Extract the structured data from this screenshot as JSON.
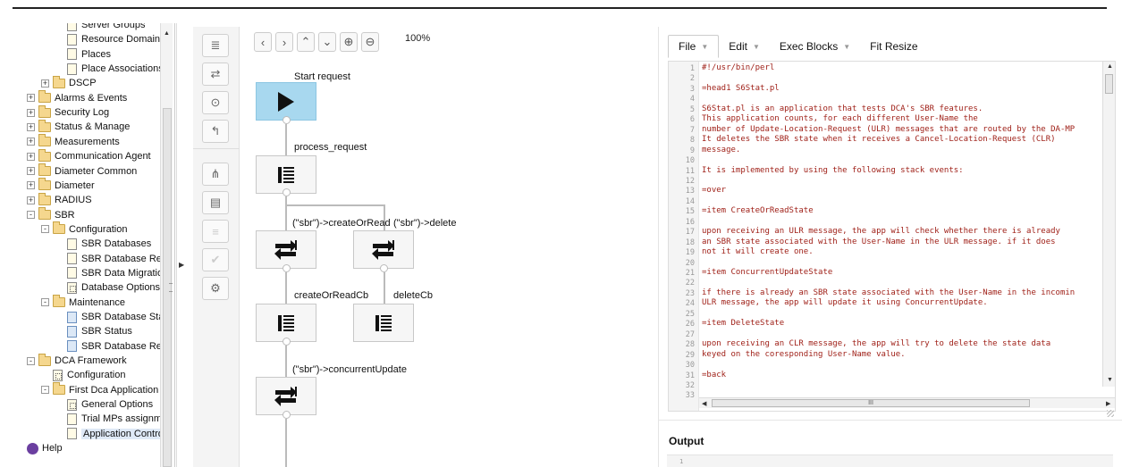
{
  "tree": {
    "items": [
      {
        "label": "Server Groups",
        "icon": "doc-icon",
        "level": 2
      },
      {
        "label": "Resource Domains",
        "icon": "doc-icon",
        "level": 2
      },
      {
        "label": "Places",
        "icon": "doc-icon",
        "level": 2
      },
      {
        "label": "Place Associations",
        "icon": "doc-icon",
        "level": 2
      },
      {
        "label": "DSCP",
        "icon": "folder-icon",
        "level": 1,
        "toggle": "+"
      },
      {
        "label": "Alarms & Events",
        "icon": "folder-icon",
        "level": 0,
        "toggle": "+"
      },
      {
        "label": "Security Log",
        "icon": "folder-icon",
        "level": 0,
        "toggle": "+"
      },
      {
        "label": "Status & Manage",
        "icon": "folder-icon",
        "level": 0,
        "toggle": "+"
      },
      {
        "label": "Measurements",
        "icon": "folder-icon",
        "level": 0,
        "toggle": "+"
      },
      {
        "label": "Communication Agent",
        "icon": "folder-icon",
        "level": 0,
        "toggle": "+"
      },
      {
        "label": "Diameter Common",
        "icon": "folder-icon",
        "level": 0,
        "toggle": "+"
      },
      {
        "label": "Diameter",
        "icon": "folder-icon",
        "level": 0,
        "toggle": "+"
      },
      {
        "label": "RADIUS",
        "icon": "folder-icon",
        "level": 0,
        "toggle": "+"
      },
      {
        "label": "SBR",
        "icon": "folder-icon",
        "level": 0,
        "toggle": "-"
      },
      {
        "label": "Configuration",
        "icon": "folder-icon",
        "level": 1,
        "toggle": "-"
      },
      {
        "label": "SBR Databases",
        "icon": "doc-icon",
        "level": 2
      },
      {
        "label": "SBR Database Res",
        "icon": "doc-icon",
        "level": 2
      },
      {
        "label": "SBR Data Migration",
        "icon": "doc-icon",
        "level": 2
      },
      {
        "label": "Database Options",
        "icon": "grid-doc-icon",
        "level": 2
      },
      {
        "label": "Maintenance",
        "icon": "folder-icon",
        "level": 1,
        "toggle": "-"
      },
      {
        "label": "SBR Database Stat",
        "icon": "blue-doc-icon",
        "level": 2
      },
      {
        "label": "SBR Status",
        "icon": "blue-doc-icon",
        "level": 2
      },
      {
        "label": "SBR Database Rec",
        "icon": "blue-doc-icon",
        "level": 2
      },
      {
        "label": "DCA Framework",
        "icon": "folder-icon",
        "level": 0,
        "toggle": "-"
      },
      {
        "label": "Configuration",
        "icon": "grid-doc-icon",
        "level": 1
      },
      {
        "label": "First Dca Application",
        "icon": "folder-icon",
        "level": 1,
        "toggle": "-"
      },
      {
        "label": "General Options",
        "icon": "grid-doc-icon",
        "level": 2
      },
      {
        "label": "Trial MPs assignme",
        "icon": "doc-icon",
        "level": 2
      },
      {
        "label": "Application Control",
        "icon": "doc-icon",
        "level": 2,
        "selected": true
      },
      {
        "label": "Help",
        "icon": "help-icon",
        "level": 0
      }
    ]
  },
  "toolbar": {
    "zoom": "100%",
    "nav": [
      "<",
      ">",
      "^",
      "v",
      "+",
      "-"
    ]
  },
  "flow": {
    "start_label": "Start request",
    "process_label": "process_request",
    "create_label": "(\"sbr\")->createOrRead",
    "delete_label": "(\"sbr\")->delete",
    "create_cb_label": "createOrReadCb",
    "delete_cb_label": "deleteCb",
    "concurrent_label": "(\"sbr\")->concurrentUpdate"
  },
  "editor": {
    "menus": [
      {
        "label": "File",
        "has_caret": true
      },
      {
        "label": "Edit",
        "has_caret": true
      },
      {
        "label": "Exec Blocks",
        "has_caret": true
      },
      {
        "label": "Fit Resize",
        "has_caret": false
      }
    ],
    "code_lines": [
      "#!/usr/bin/perl",
      "",
      "=head1 S6Stat.pl",
      "",
      "S6Stat.pl is an application that tests DCA's SBR features.",
      "This application counts, for each different User-Name the",
      "number of Update-Location-Request (ULR) messages that are routed by the DA-MP",
      "It deletes the SBR state when it receives a Cancel-Location-Request (CLR)",
      "message.",
      "",
      "It is implemented by using the following stack events:",
      "",
      "=over",
      "",
      "=item CreateOrReadState",
      "",
      "upon receiving an ULR message, the app will check whether there is already",
      "an SBR state associated with the User-Name in the ULR message. if it does",
      "not it will create one.",
      "",
      "=item ConcurrentUpdateState",
      "",
      "if there is already an SBR state associated with the User-Name in the incomin",
      "ULR message, the app will update it using ConcurrentUpdate.",
      "",
      "=item DeleteState",
      "",
      "upon receiving an CLR message, the app will try to delete the state data",
      "keyed on the coresponding User-Name value.",
      "",
      "=back",
      "",
      ""
    ],
    "line_numbers": [
      "1",
      "2",
      "3",
      "4",
      "5",
      "6",
      "7",
      "8",
      "9",
      "10",
      "11",
      "12",
      "13",
      "14",
      "15",
      "16",
      "17",
      "18",
      "19",
      "20",
      "21",
      "22",
      "23",
      "24",
      "25",
      "26",
      "27",
      "28",
      "29",
      "30",
      "31",
      "32",
      "33"
    ],
    "hscroll_thumb": "III",
    "output_title": "Output",
    "output_line": "1"
  }
}
